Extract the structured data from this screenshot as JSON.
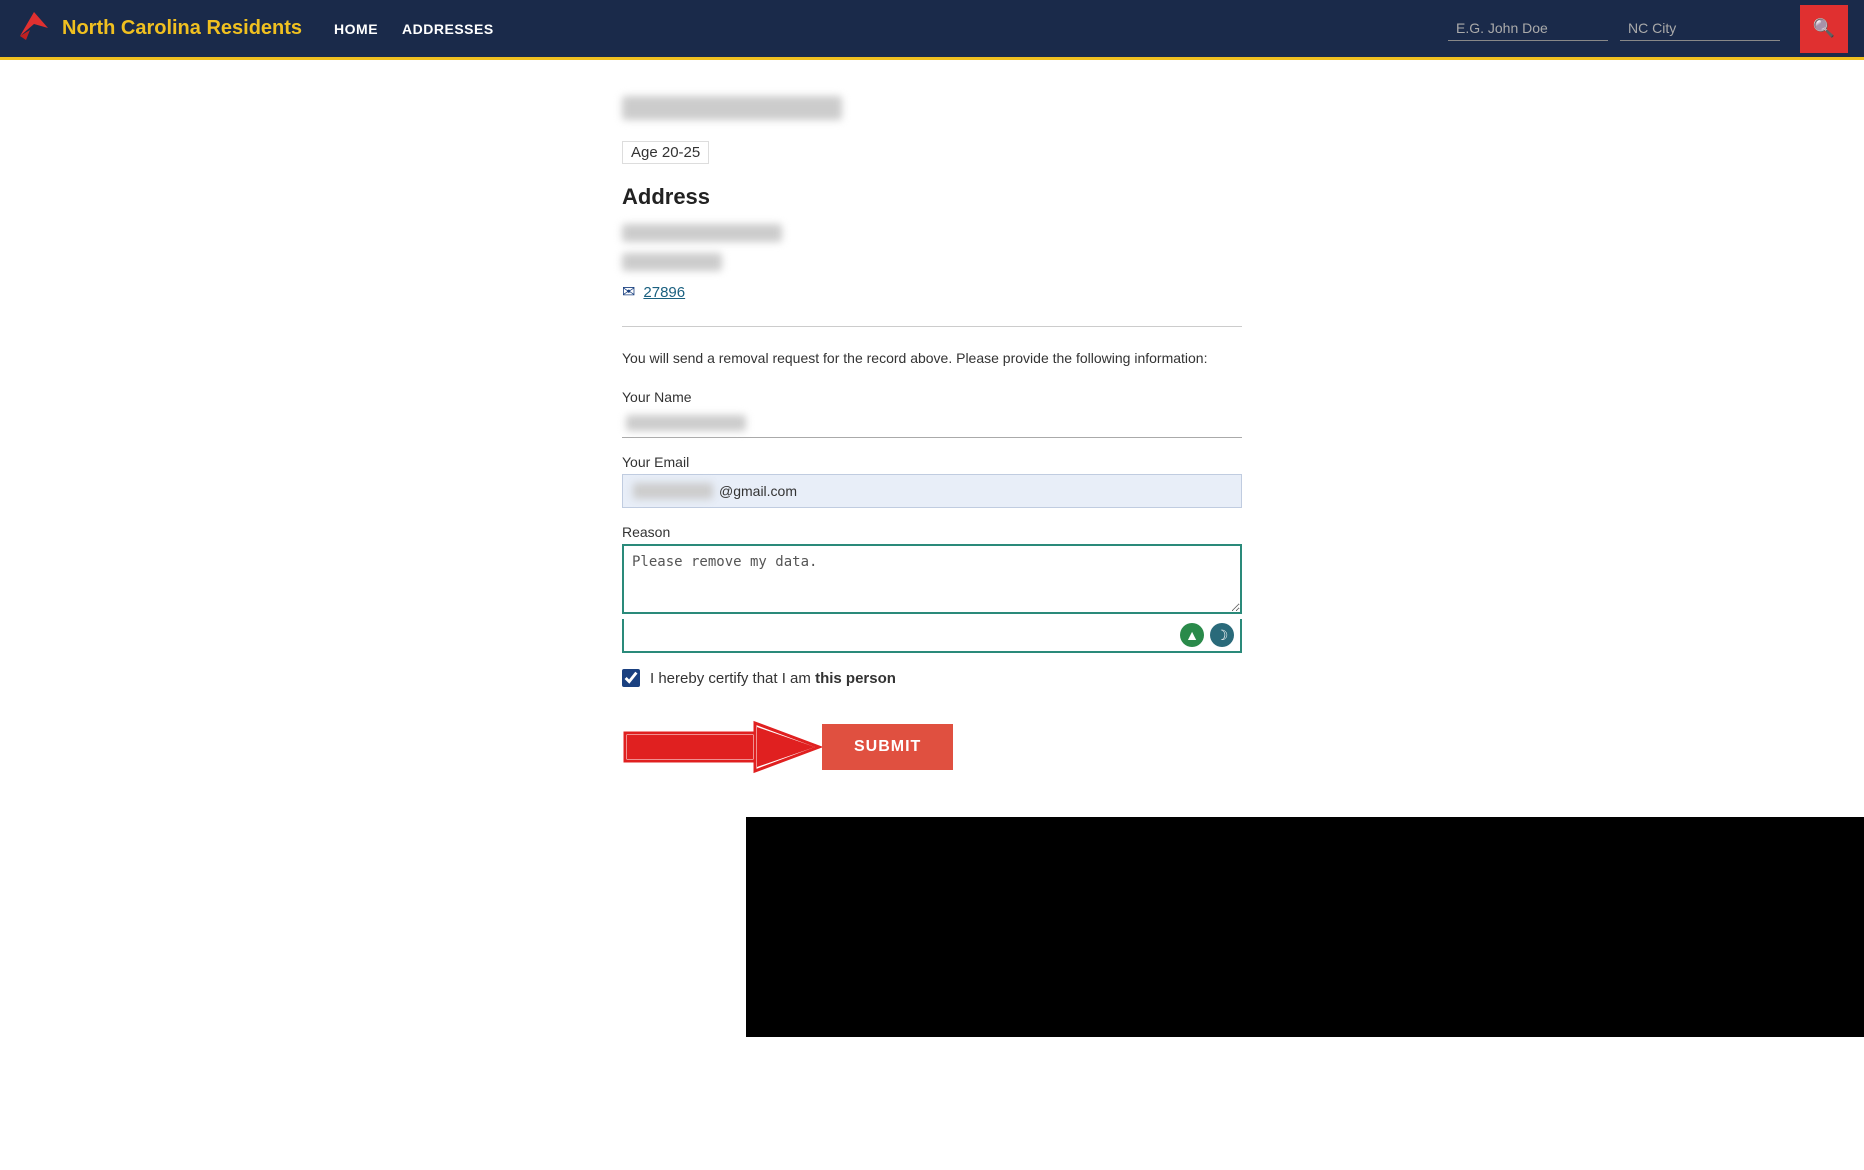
{
  "navbar": {
    "logo_symbol": "🦅",
    "title": "North Carolina Residents",
    "nav_items": [
      {
        "label": "HOME",
        "href": "#"
      },
      {
        "label": "ADDRESSES",
        "href": "#"
      }
    ],
    "search_placeholder_name": "E.G. John Doe",
    "search_placeholder_city": "NC City",
    "search_icon": "🔍"
  },
  "record": {
    "age_range": "Age 20-25",
    "address_section_title": "Address",
    "zip": "27896"
  },
  "form": {
    "removal_info": "You will send a removal request for the record above. Please provide the following information:",
    "your_name_label": "Your Name",
    "your_email_label": "Your Email",
    "email_suffix": "@gmail.com",
    "reason_label": "Reason",
    "reason_placeholder": "Please remove my data.",
    "certify_label": "I hereby certify that I am this person",
    "submit_label": "SUBMIT"
  }
}
